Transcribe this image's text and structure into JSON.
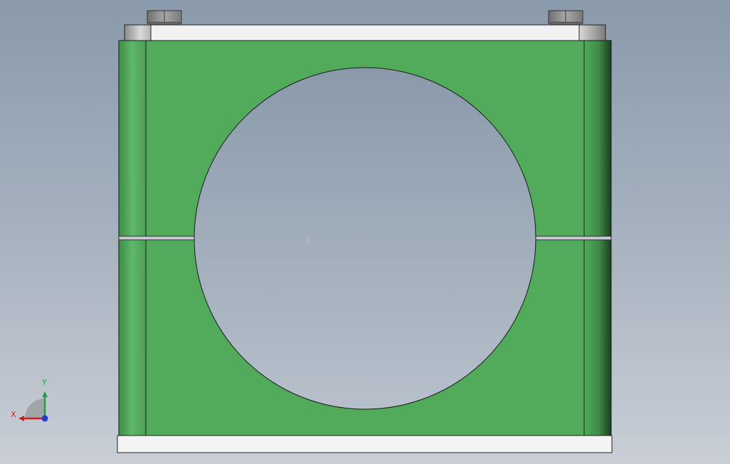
{
  "viewport": {
    "background_top": "#8a9aab",
    "background_bottom": "#c9ced6"
  },
  "model": {
    "part_color": "#52aa5b",
    "part_color_dark": "#1f4a23",
    "plate_color": "#f2f2f2",
    "bolt_color": "#8d8d8d"
  },
  "watermark": {
    "text": "Â     "
  },
  "triad": {
    "x_label": "X",
    "y_label": "Y",
    "x_color": "#cc2020",
    "y_color": "#20a040",
    "z_color": "#2040cc"
  }
}
